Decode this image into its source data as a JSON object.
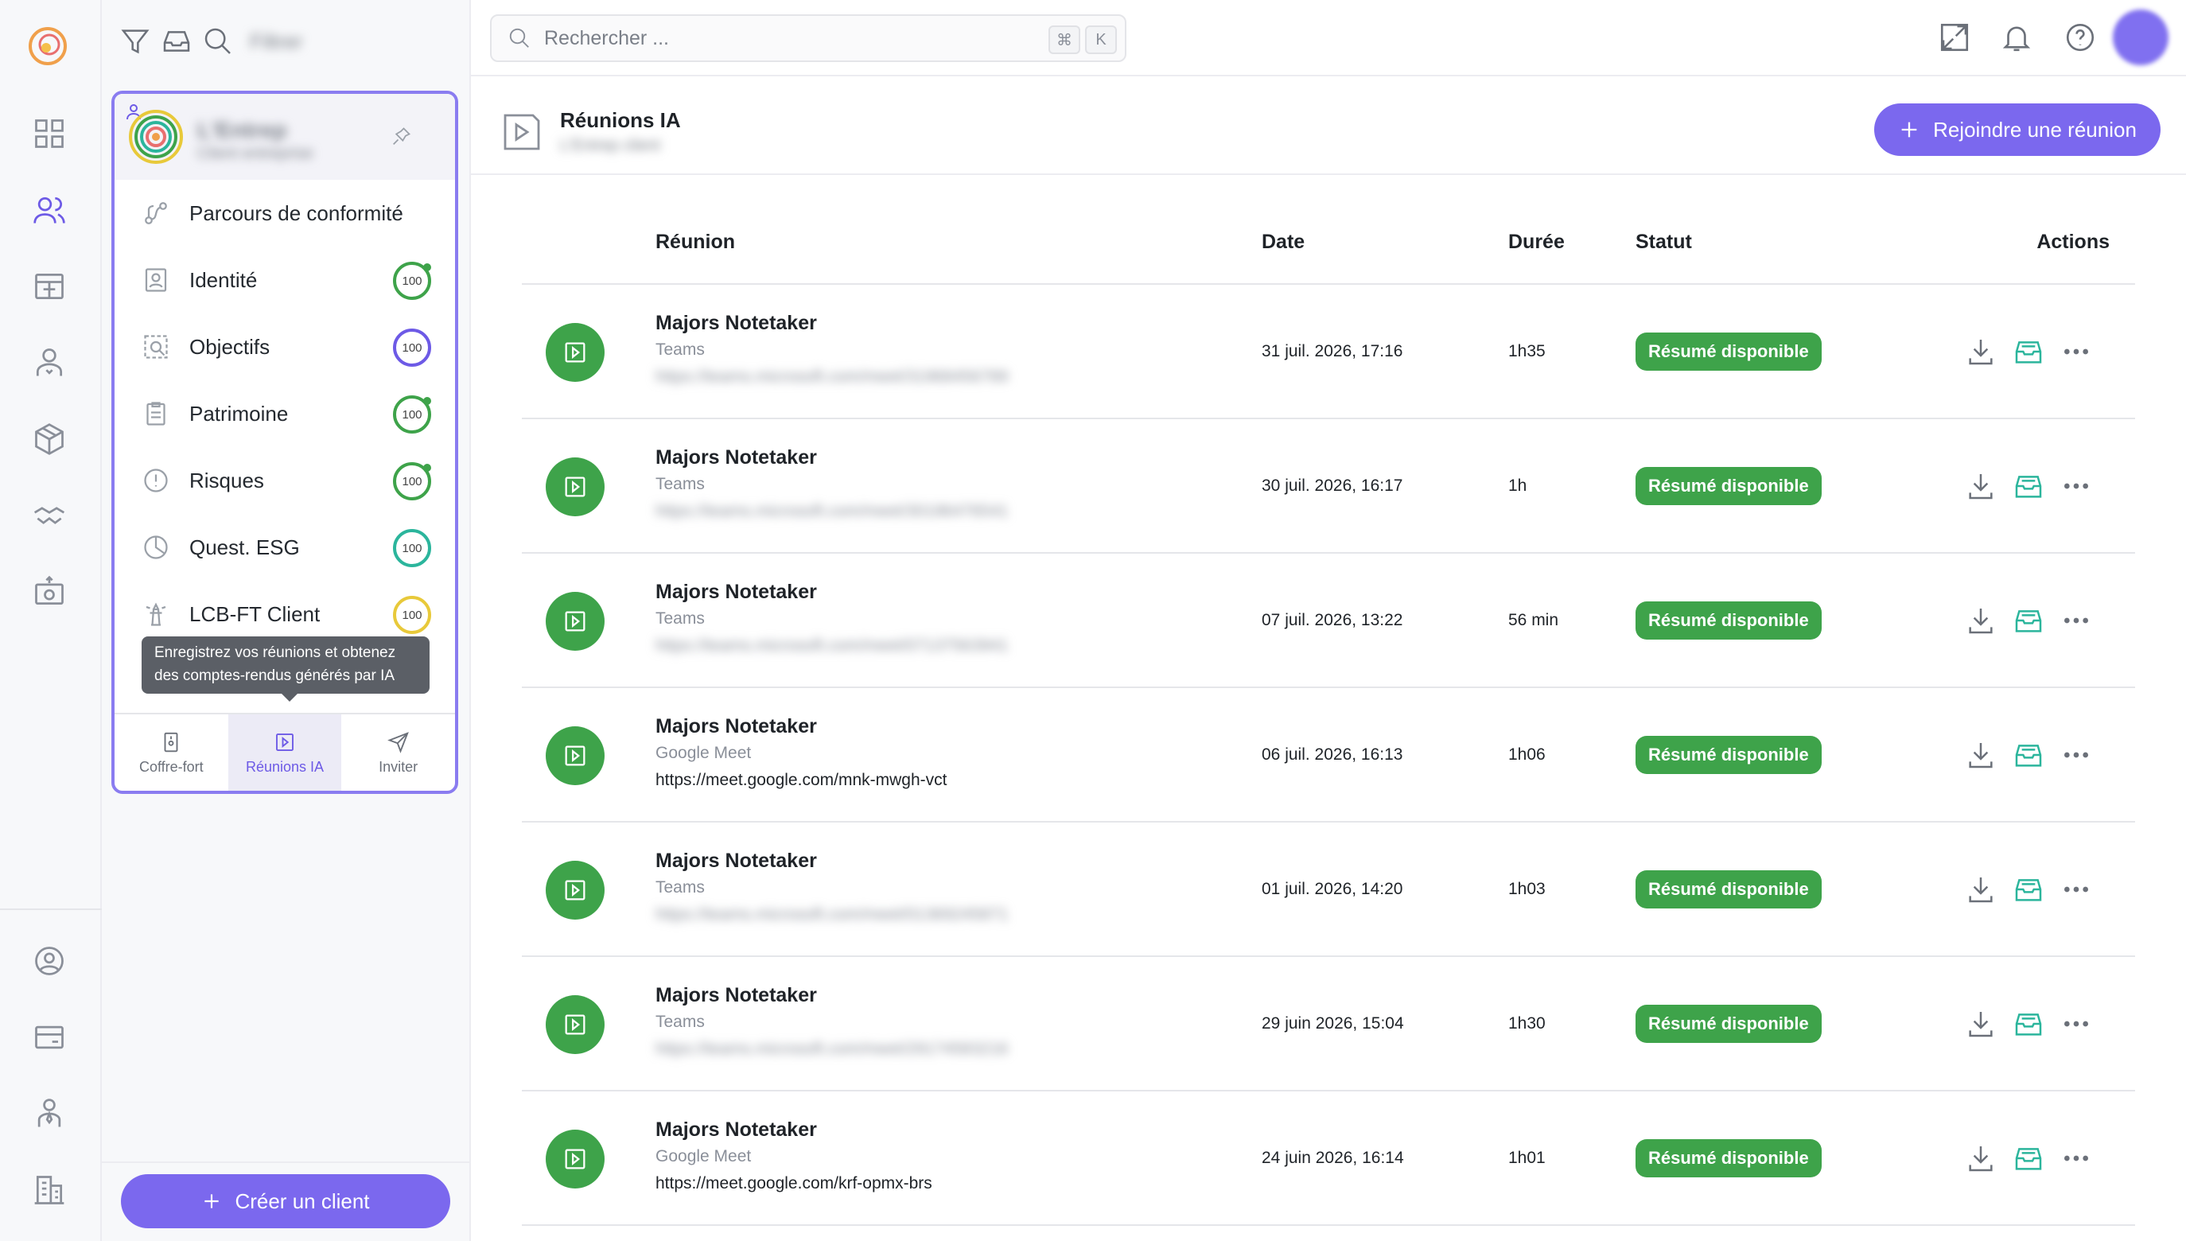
{
  "app": {
    "logo_icon": "swirl-logo-icon",
    "accent": "#7b68ee",
    "success": "#3ea34a"
  },
  "rail": {
    "items": [
      "dashboard-icon",
      "users-icon",
      "layout-icon",
      "user-badge-icon",
      "box-icon",
      "handshake-icon",
      "camera-upload-icon"
    ],
    "bottom": [
      "user-circle-icon",
      "credit-card-icon",
      "person-tie-icon",
      "building-icon"
    ]
  },
  "panel": {
    "filter_icons": [
      "filter-icon",
      "inbox-icon",
      "search-icon"
    ],
    "filter_text": "Filtrer",
    "client": {
      "name": "L'Entrep",
      "sub": "Client entreprise"
    },
    "menu": [
      {
        "label": "Parcours de conformité",
        "icon": "route-icon",
        "score": null
      },
      {
        "label": "Identité",
        "icon": "id-card-icon",
        "score": "100",
        "color": "#3ea34a"
      },
      {
        "label": "Objectifs",
        "icon": "target-icon",
        "score": "100",
        "color": "#6d5ae6"
      },
      {
        "label": "Patrimoine",
        "icon": "clipboard-icon",
        "score": "100",
        "color": "#3ea34a"
      },
      {
        "label": "Risques",
        "icon": "alert-circle-icon",
        "score": "100",
        "color": "#3ea34a"
      },
      {
        "label": "Quest. ESG",
        "icon": "pie-icon",
        "score": "100",
        "color": "#2bb59c"
      },
      {
        "label": "LCB-FT Client",
        "icon": "lighthouse-icon",
        "score": "100",
        "color": "#e8c93a"
      }
    ],
    "tooltip": "Enregistrez vos réunions et obtenez des comptes-rendus générés par IA",
    "tabs": [
      {
        "label": "Coffre-fort",
        "icon": "safe-icon"
      },
      {
        "label": "Réunions IA",
        "icon": "video-play-icon"
      },
      {
        "label": "Inviter",
        "icon": "send-icon"
      }
    ],
    "create_button": "Créer un client"
  },
  "topbar": {
    "search_placeholder": "Rechercher ...",
    "kbd_cmd": "⌘",
    "kbd_k": "K"
  },
  "page": {
    "title": "Réunions IA",
    "subtitle": "L'Entrep client",
    "join_button": "Rejoindre une réunion"
  },
  "table": {
    "headers": {
      "meeting": "Réunion",
      "date": "Date",
      "duration": "Durée",
      "status": "Statut",
      "actions": "Actions"
    },
    "rows": [
      {
        "name": "Majors Notetaker",
        "platform": "Teams",
        "link": "https://teams.microsoft.com/meet/31968456789",
        "link_blurred": true,
        "date": "31 juil. 2026, 17:16",
        "duration": "1h35",
        "status": "Résumé disponible"
      },
      {
        "name": "Majors Notetaker",
        "platform": "Teams",
        "link": "https://teams.microsoft.com/meet/30196476541",
        "link_blurred": true,
        "date": "30 juil. 2026, 16:17",
        "duration": "1h",
        "status": "Résumé disponible"
      },
      {
        "name": "Majors Notetaker",
        "platform": "Teams",
        "link": "https://teams.microsoft.com/meet/07137563941",
        "link_blurred": true,
        "date": "07 juil. 2026, 13:22",
        "duration": "56 min",
        "status": "Résumé disponible"
      },
      {
        "name": "Majors Notetaker",
        "platform": "Google Meet",
        "link": "https://meet.google.com/mnk-mwgh-vct",
        "link_blurred": false,
        "date": "06 juil. 2026, 16:13",
        "duration": "1h06",
        "status": "Résumé disponible"
      },
      {
        "name": "Majors Notetaker",
        "platform": "Teams",
        "link": "https://teams.microsoft.com/meet/01369245871",
        "link_blurred": true,
        "date": "01 juil. 2026, 14:20",
        "duration": "1h03",
        "status": "Résumé disponible"
      },
      {
        "name": "Majors Notetaker",
        "platform": "Teams",
        "link": "https://teams.microsoft.com/meet/29174583216",
        "link_blurred": true,
        "date": "29 juin 2026, 15:04",
        "duration": "1h30",
        "status": "Résumé disponible"
      },
      {
        "name": "Majors Notetaker",
        "platform": "Google Meet",
        "link": "https://meet.google.com/krf-opmx-brs",
        "link_blurred": false,
        "date": "24 juin 2026, 16:14",
        "duration": "1h01",
        "status": "Résumé disponible"
      }
    ],
    "row_actions": [
      "download-icon",
      "archive-icon",
      "more-icon"
    ]
  }
}
